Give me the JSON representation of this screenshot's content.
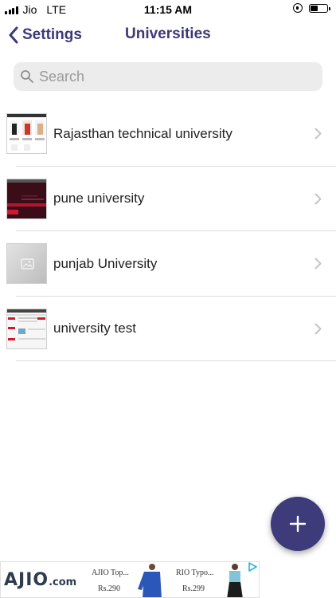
{
  "status_bar": {
    "carrier": "Jio",
    "network": "LTE",
    "time": "11:15 AM"
  },
  "nav": {
    "back_label": "Settings",
    "title": "Universities"
  },
  "search": {
    "placeholder": "Search"
  },
  "list": [
    {
      "label": "Rajasthan technical university",
      "thumb": "rtu"
    },
    {
      "label": "pune university",
      "thumb": "pune"
    },
    {
      "label": "punjab University",
      "thumb": "punjab"
    },
    {
      "label": "university test",
      "thumb": "test"
    }
  ],
  "ad": {
    "brand": "AJIO",
    "brand_suffix": ".com",
    "products": [
      {
        "title": "AJIO Top...",
        "price": "Rs.290"
      },
      {
        "title": "RIO Typo...",
        "price": "Rs.299"
      }
    ]
  },
  "colors": {
    "accent": "#3b3a78",
    "fab": "#3e3b7a"
  },
  "icons": {
    "back": "chevron-left-icon",
    "search": "search-icon",
    "row_chevron": "chevron-right-icon",
    "fab": "plus-icon"
  }
}
